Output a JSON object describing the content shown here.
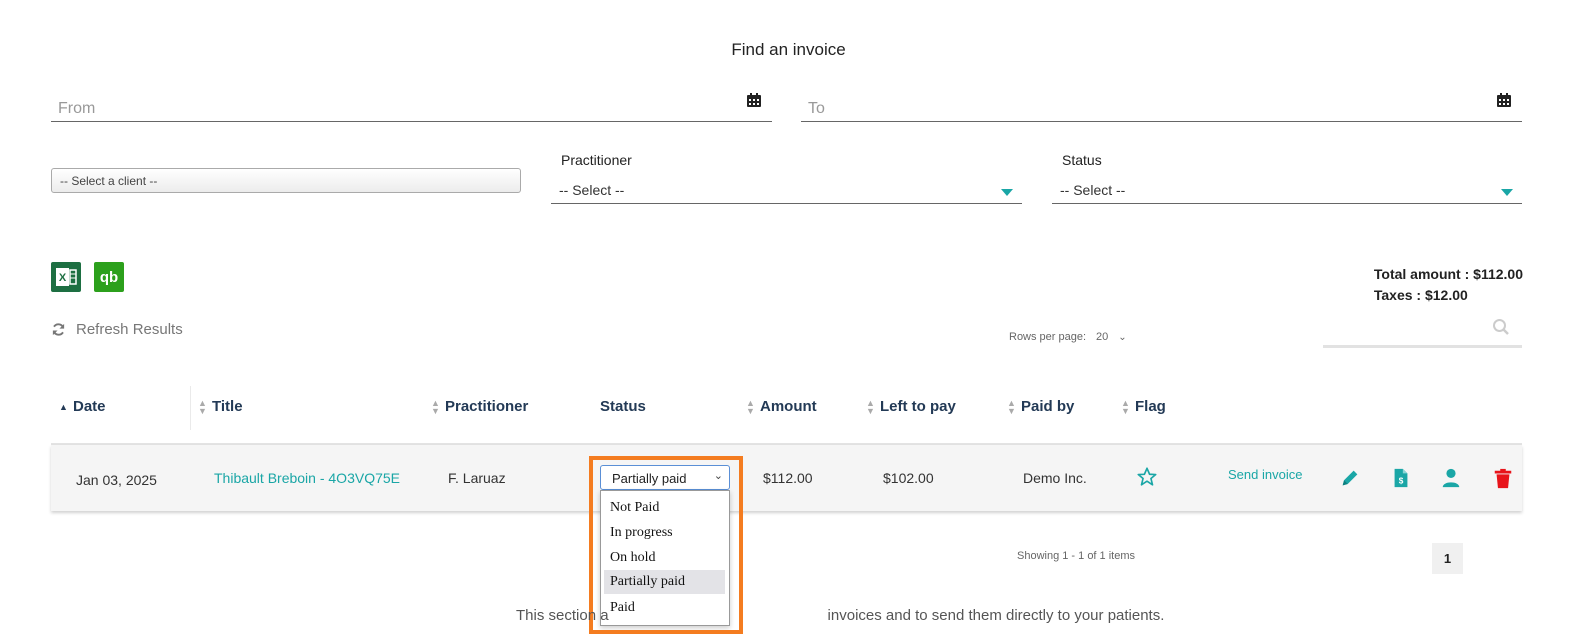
{
  "page": {
    "title": "Find an invoice"
  },
  "filters": {
    "from_placeholder": "From",
    "to_placeholder": "To",
    "client_select": "-- Select a client --",
    "practitioner": {
      "label": "Practitioner",
      "value": "-- Select --"
    },
    "status": {
      "label": "Status",
      "value": "-- Select --"
    }
  },
  "export": {
    "excel_label": "X",
    "qb_label": "qb"
  },
  "totals": {
    "amount": "Total amount : $112.00",
    "taxes": "Taxes : $12.00"
  },
  "toolbar": {
    "refresh_label": "Refresh Results",
    "rows_per_page_label": "Rows per page:",
    "rows_per_page_value": "20"
  },
  "table": {
    "columns": [
      "Date",
      "Title",
      "Practitioner",
      "Status",
      "Amount",
      "Left to pay",
      "Paid by",
      "Flag"
    ],
    "rows": [
      {
        "date": "Jan 03, 2025",
        "title": "Thibault Breboin - 4O3VQ75E",
        "practitioner": "F. Laruaz",
        "status": "Partially paid",
        "amount": "$112.00",
        "left_to_pay": "$102.00",
        "paid_by": "Demo Inc.",
        "send_invoice": "Send invoice"
      }
    ]
  },
  "status_options": [
    "Not Paid",
    "In progress",
    "On hold",
    "Partially paid",
    "Paid"
  ],
  "status_selected": "Partially paid",
  "pagination": {
    "showing": "Showing 1 - 1 of 1 items",
    "page": "1"
  },
  "footer": {
    "text_left": "This section a",
    "text_right": "invoices and to send them directly to your patients."
  },
  "colors": {
    "accent": "#1aa6a6",
    "header_text": "#233a56",
    "delete": "#e8141a",
    "highlight": "#f47c20"
  },
  "icons": [
    "calendar-icon",
    "excel-icon",
    "quickbooks-icon",
    "refresh-icon",
    "search-icon",
    "star-icon",
    "pencil-icon",
    "invoice-icon",
    "user-icon",
    "trash-icon"
  ]
}
